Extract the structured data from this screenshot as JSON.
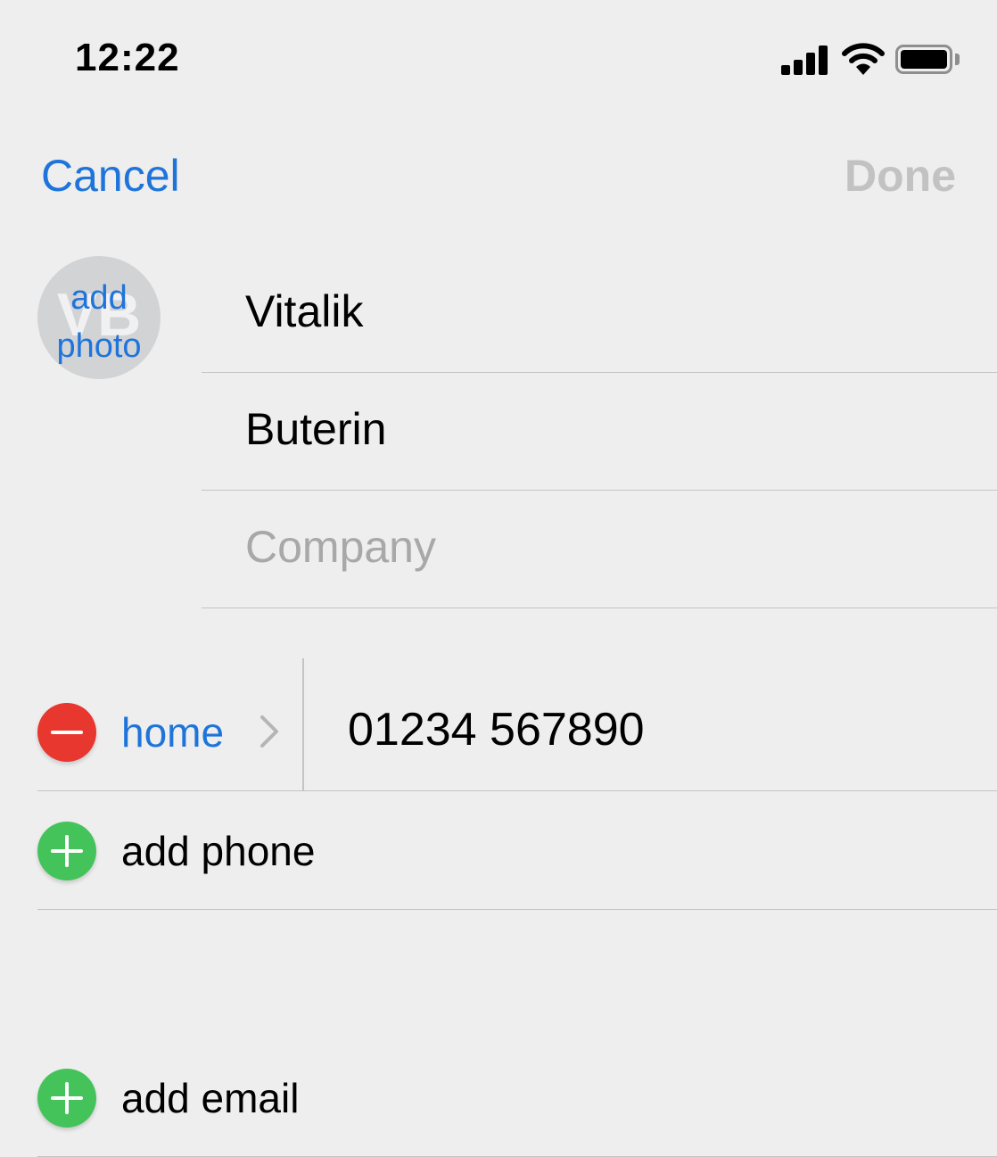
{
  "status_bar": {
    "time": "12:22"
  },
  "nav": {
    "cancel": "Cancel",
    "done": "Done"
  },
  "avatar": {
    "initials": "VB",
    "add_photo": [
      "add",
      "photo"
    ]
  },
  "fields": {
    "first_name": "Vitalik",
    "last_name": "Buterin",
    "company_placeholder": "Company"
  },
  "phones": [
    {
      "type": "home",
      "number": "01234 567890"
    }
  ],
  "actions": {
    "add_phone": "add phone",
    "add_email": "add email"
  },
  "colors": {
    "accent": "#1f74db",
    "remove": "#e8372e",
    "add": "#45c35b",
    "background": "#edeeed"
  }
}
